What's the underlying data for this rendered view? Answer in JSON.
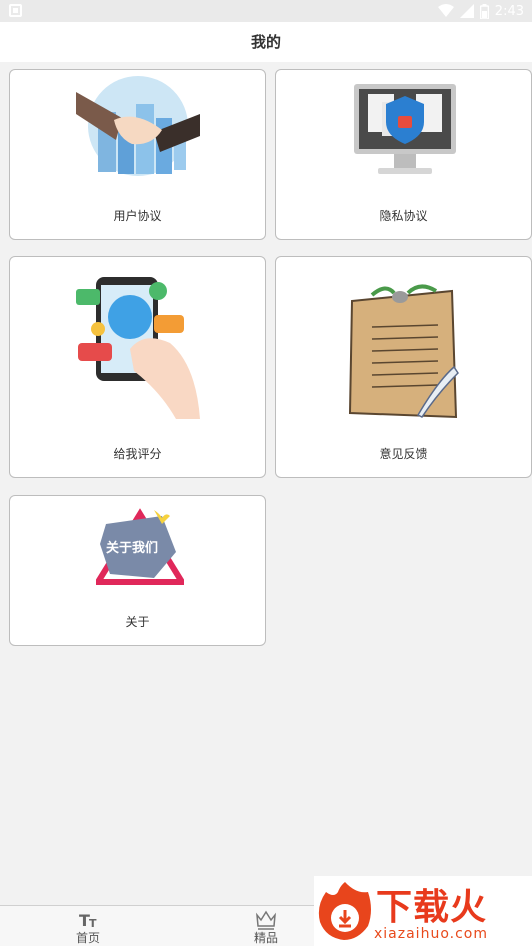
{
  "status_bar": {
    "time": "2:43"
  },
  "header": {
    "title": "我的"
  },
  "cards": [
    {
      "label": "用户协议",
      "icon": "handshake-icon"
    },
    {
      "label": "隐私协议",
      "icon": "privacy-shield-monitor-icon"
    },
    {
      "label": "给我评分",
      "icon": "phone-thumbs-up-icon"
    },
    {
      "label": "意见反馈",
      "icon": "survey-report-icon"
    },
    {
      "label": "关于",
      "icon": "about-us-icon",
      "image_text": "关于我们"
    }
  ],
  "bottom_nav": [
    {
      "label": "首页",
      "icon": "text-size-icon"
    },
    {
      "label": "精品",
      "icon": "crown-icon"
    }
  ],
  "watermark": {
    "text": "下载火",
    "url": "xiazaihuo.com"
  }
}
